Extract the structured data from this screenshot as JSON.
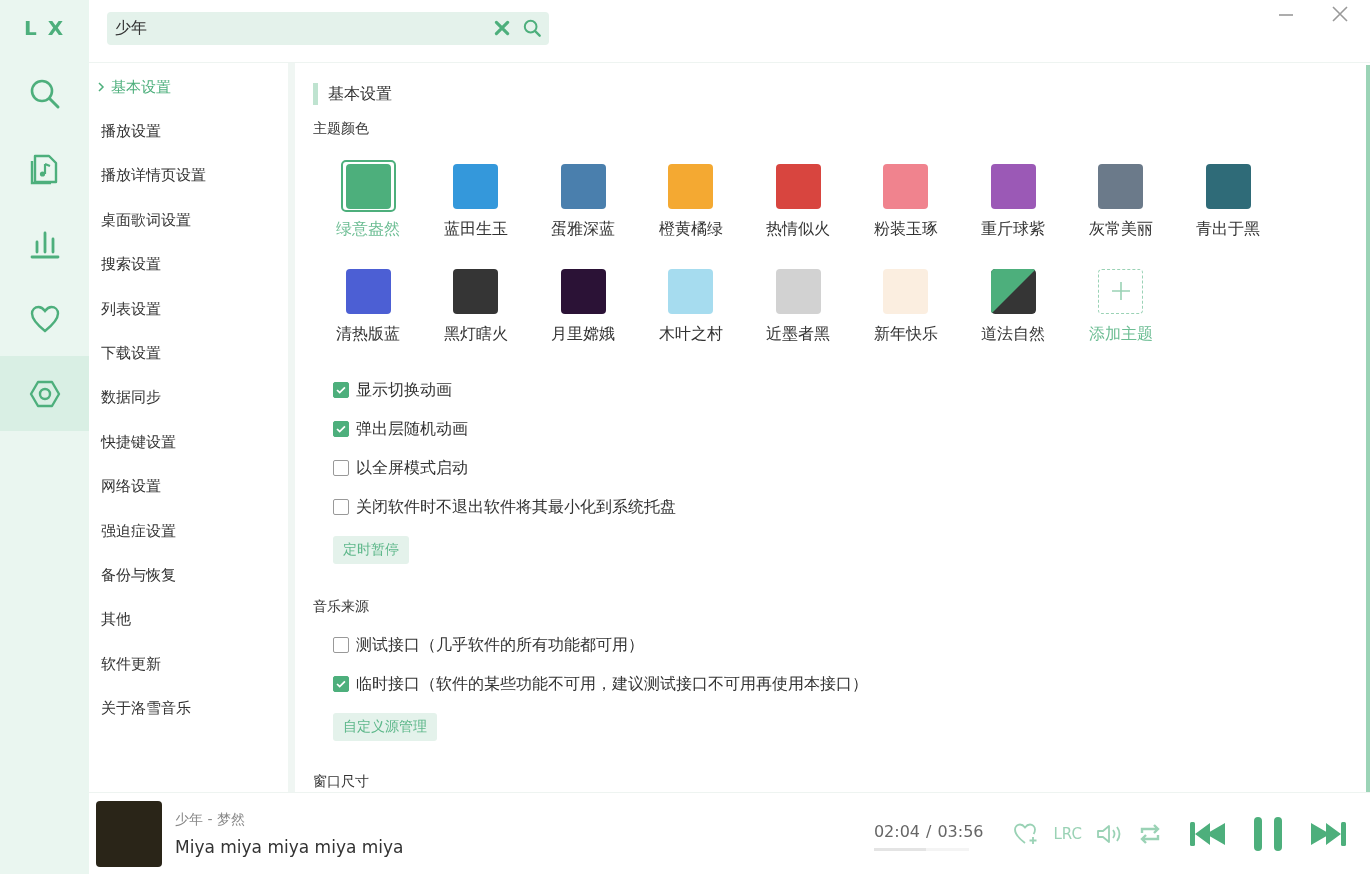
{
  "logo": "L X",
  "search": {
    "value": "少年"
  },
  "rail": [
    {
      "selected": false
    },
    {
      "selected": false
    },
    {
      "selected": false
    },
    {
      "selected": false
    },
    {
      "selected": true
    }
  ],
  "settings_nav": [
    {
      "label": "基本设置",
      "selected": true
    },
    {
      "label": "播放设置",
      "selected": false
    },
    {
      "label": "播放详情页设置",
      "selected": false
    },
    {
      "label": "桌面歌词设置",
      "selected": false
    },
    {
      "label": "搜索设置",
      "selected": false
    },
    {
      "label": "列表设置",
      "selected": false
    },
    {
      "label": "下载设置",
      "selected": false
    },
    {
      "label": "数据同步",
      "selected": false
    },
    {
      "label": "快捷键设置",
      "selected": false
    },
    {
      "label": "网络设置",
      "selected": false
    },
    {
      "label": "强迫症设置",
      "selected": false
    },
    {
      "label": "备份与恢复",
      "selected": false
    },
    {
      "label": "其他",
      "selected": false
    },
    {
      "label": "软件更新",
      "selected": false
    },
    {
      "label": "关于洛雪音乐",
      "selected": false
    }
  ],
  "section_title": "基本设置",
  "theme_heading": "主题颜色",
  "themes": [
    {
      "name": "绿意盎然",
      "kind": "color",
      "color": "#4daf7c",
      "selected": true
    },
    {
      "name": "蓝田生玉",
      "kind": "color",
      "color": "#3498db",
      "selected": false
    },
    {
      "name": "蛋雅深蓝",
      "kind": "color",
      "color": "#4a7fad",
      "selected": false
    },
    {
      "name": "橙黄橘绿",
      "kind": "color",
      "color": "#f4a932",
      "selected": false
    },
    {
      "name": "热情似火",
      "kind": "color",
      "color": "#d8453f",
      "selected": false
    },
    {
      "name": "粉装玉琢",
      "kind": "color",
      "color": "#f0838e",
      "selected": false
    },
    {
      "name": "重斤球紫",
      "kind": "color",
      "color": "#9b59b6",
      "selected": false
    },
    {
      "name": "灰常美丽",
      "kind": "color",
      "color": "#6b7a8a",
      "selected": false
    },
    {
      "name": "青出于黑",
      "kind": "color",
      "color": "#2f6b78",
      "selected": false
    },
    {
      "name": "清热版蓝",
      "kind": "color",
      "color": "#4c5fd4",
      "selected": false
    },
    {
      "name": "黑灯瞎火",
      "kind": "image",
      "color": "#353535",
      "selected": false
    },
    {
      "name": "月里嫦娥",
      "kind": "image",
      "color": "#2b1236",
      "selected": false
    },
    {
      "name": "木叶之村",
      "kind": "image",
      "color": "#a6dcef",
      "selected": false
    },
    {
      "name": "近墨者黑",
      "kind": "image",
      "color": "#d2d2d2",
      "selected": false
    },
    {
      "name": "新年快乐",
      "kind": "image",
      "color": "#fbeee0",
      "selected": false
    },
    {
      "name": "道法自然",
      "kind": "split",
      "color": "#4daf7c",
      "selected": false
    },
    {
      "name": "添加主题",
      "kind": "add",
      "color": "#9ad2b5",
      "selected": false
    }
  ],
  "options": [
    {
      "label": "显示切换动画",
      "checked": true
    },
    {
      "label": "弹出层随机动画",
      "checked": true
    },
    {
      "label": "以全屏模式启动",
      "checked": false
    },
    {
      "label": "关闭软件时不退出软件将其最小化到系统托盘",
      "checked": false
    }
  ],
  "timer_button": "定时暂停",
  "source_heading": "音乐来源",
  "sources": [
    {
      "label": "测试接口（几乎软件的所有功能都可用）",
      "checked": false
    },
    {
      "label": "临时接口（软件的某些功能不可用，建议测试接口不可用再使用本接口）",
      "checked": true
    }
  ],
  "source_button": "自定义源管理",
  "window_size_heading": "窗口尺寸",
  "player": {
    "title": "少年 - 梦然",
    "lyric": "Miya miya miya miya miya",
    "elapsed": "02:04",
    "separator": "/",
    "duration": "03:56",
    "level": 0.55,
    "lrc": "LRC"
  }
}
